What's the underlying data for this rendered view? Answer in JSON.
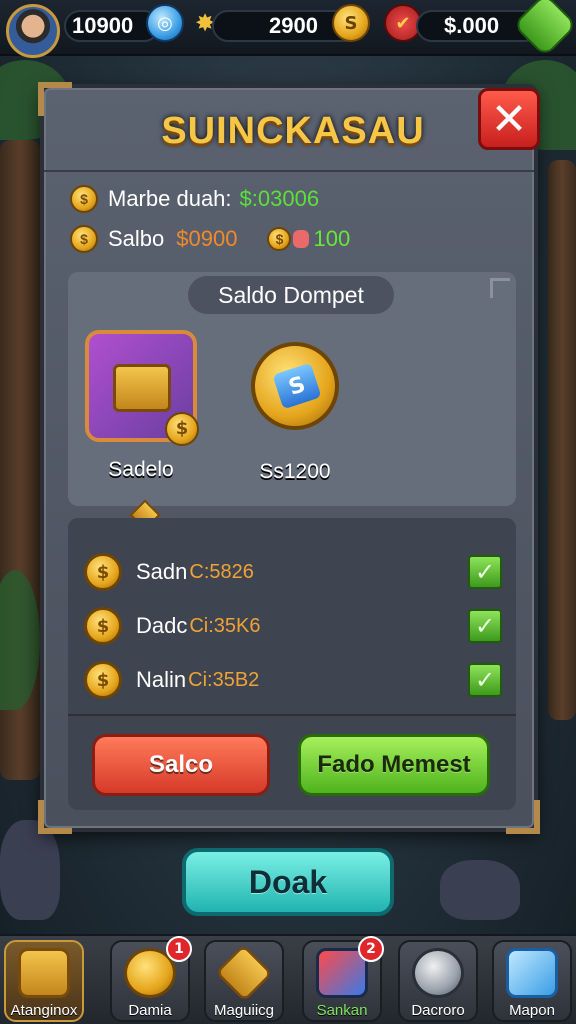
{
  "topbar": {
    "resource1": "10900",
    "resource2": "2900",
    "resource3": "$.000"
  },
  "panel": {
    "title": "SUINCKASAU",
    "close_icon": "close-icon",
    "info": [
      {
        "label": "Marbe duah:",
        "value": "$:03006",
        "value_color": "#5be03a"
      },
      {
        "label": "Salbo",
        "value": "$0900",
        "value_color": "#f08a2a",
        "extra": "100",
        "extra_color": "#66e63a"
      }
    ]
  },
  "wallet": {
    "title": "Saldo Dompet",
    "items": [
      {
        "label": "Sadelo",
        "icon": "treasure-chest-icon"
      },
      {
        "label": "Ss1200",
        "icon": "gem-coin-icon"
      }
    ]
  },
  "list": [
    {
      "label": "Sadn",
      "amount": "C:5826"
    },
    {
      "label": "Dadc",
      "amount": "Ci:35K6"
    },
    {
      "label": "Nalin",
      "amount": "Ci:35B2"
    }
  ],
  "buttons": {
    "left": "Salco",
    "right": "Fado Memest",
    "main": "Doak"
  },
  "nav": [
    {
      "label": "Atanginox",
      "badge": ""
    },
    {
      "label": "Damia",
      "badge": "1"
    },
    {
      "label": "Maguiicg",
      "badge": ""
    },
    {
      "label": "Sankan",
      "badge": "2"
    },
    {
      "label": "Dacroro",
      "badge": ""
    },
    {
      "label": "Mapon",
      "badge": ""
    }
  ],
  "colors": {
    "accent_gold": "#f6c746",
    "close_red": "#c81f1f",
    "confirm_green": "#4fb31e",
    "main_teal": "#21b3b0"
  }
}
